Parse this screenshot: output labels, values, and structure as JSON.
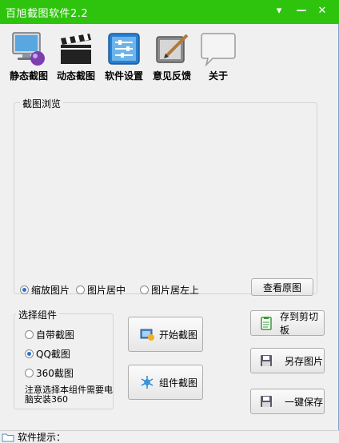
{
  "window": {
    "title": "百旭截图软件2.2",
    "controls": {
      "menu": "▾",
      "minimize": "—",
      "close": "✕"
    }
  },
  "toolbar": {
    "items": [
      {
        "label": "静态截图",
        "icon": "monitor-icon"
      },
      {
        "label": "动态截图",
        "icon": "clapperboard-icon"
      },
      {
        "label": "软件设置",
        "icon": "settings-panel-icon"
      },
      {
        "label": "意见反馈",
        "icon": "feedback-pen-icon"
      },
      {
        "label": "关于",
        "icon": "speech-bubble-icon"
      }
    ]
  },
  "preview": {
    "legend": "截图浏览",
    "options": [
      {
        "label": "缩放图片",
        "selected": true
      },
      {
        "label": "图片居中",
        "selected": false
      },
      {
        "label": "图片居左上",
        "selected": false
      }
    ],
    "view_original_label": "查看原图"
  },
  "components": {
    "legend": "选择组件",
    "options": [
      {
        "label": "自带截图",
        "selected": false
      },
      {
        "label": "QQ截图",
        "selected": true
      },
      {
        "label": "360截图",
        "selected": false
      }
    ],
    "note": "注意选择本组件需要电脑安装360"
  },
  "actions": {
    "start_capture": "开始截图",
    "component_capture": "组件截图",
    "save_clipboard": "存到剪切板",
    "save_as": "另存图片",
    "one_click_save": "一键保存"
  },
  "status": {
    "label": "软件提示："
  },
  "colors": {
    "titlebar": "#2ec40e",
    "selected_radio": "#2a6fd6"
  }
}
